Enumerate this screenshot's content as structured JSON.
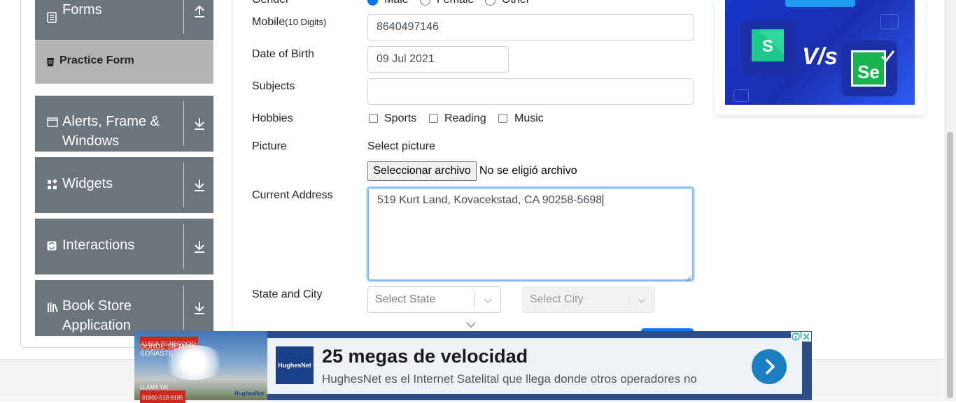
{
  "sidebar": {
    "groups": [
      {
        "label": "Forms",
        "icon": "document-icon"
      },
      {
        "label": "Alerts, Frame & Windows",
        "icon": "window-icon"
      },
      {
        "label": "Widgets",
        "icon": "widgets-icon"
      },
      {
        "label": "Interactions",
        "icon": "interactions-icon"
      },
      {
        "label": "Book Store Application",
        "icon": "books-icon"
      }
    ],
    "active_item": "Practice Form"
  },
  "form": {
    "gender_label": "Gender",
    "gender_options": [
      "Male",
      "Female",
      "Other"
    ],
    "mobile_label": "Mobile",
    "mobile_hint": "(10 Digits)",
    "mobile_value": "8640497146",
    "dob_label": "Date of Birth",
    "dob_value": "09 Jul 2021",
    "subjects_label": "Subjects",
    "subjects_value": "",
    "hobbies_label": "Hobbies",
    "hobbies": [
      "Sports",
      "Reading",
      "Music"
    ],
    "picture_label": "Picture",
    "select_picture_label": "Select picture",
    "file_button": "Seleccionar archivo",
    "file_status": "No se eligió archivo",
    "address_label": "Current Address",
    "address_value": "519 Kurt Land, Kovacekstad, CA 90258-5698",
    "state_city_label": "State and City",
    "state_placeholder": "Select State",
    "city_placeholder": "Select City"
  },
  "ad_bottom": {
    "tag_line1": "LLEVA TU NEGOCIO",
    "tag_line2": "DONDE SIEMPRE",
    "tag_line3": "SOÑASTE",
    "call_label": "LLAMA YA!",
    "phone": "01800-518-9185",
    "photo_brand": "HughesNet",
    "logo": "HughesNet",
    "headline": "25 megas de velocidad",
    "subtext": "HughesNet es el Internet Satelital que llega donde otros operadores no"
  },
  "ad_right": {
    "versus": "V/s",
    "badge_text": "Se"
  },
  "colors": {
    "sidebar_group": "#6c757d",
    "active_item": "#b3b3b3",
    "focus": "#80bdff",
    "ad_blue": "#1636c9"
  }
}
